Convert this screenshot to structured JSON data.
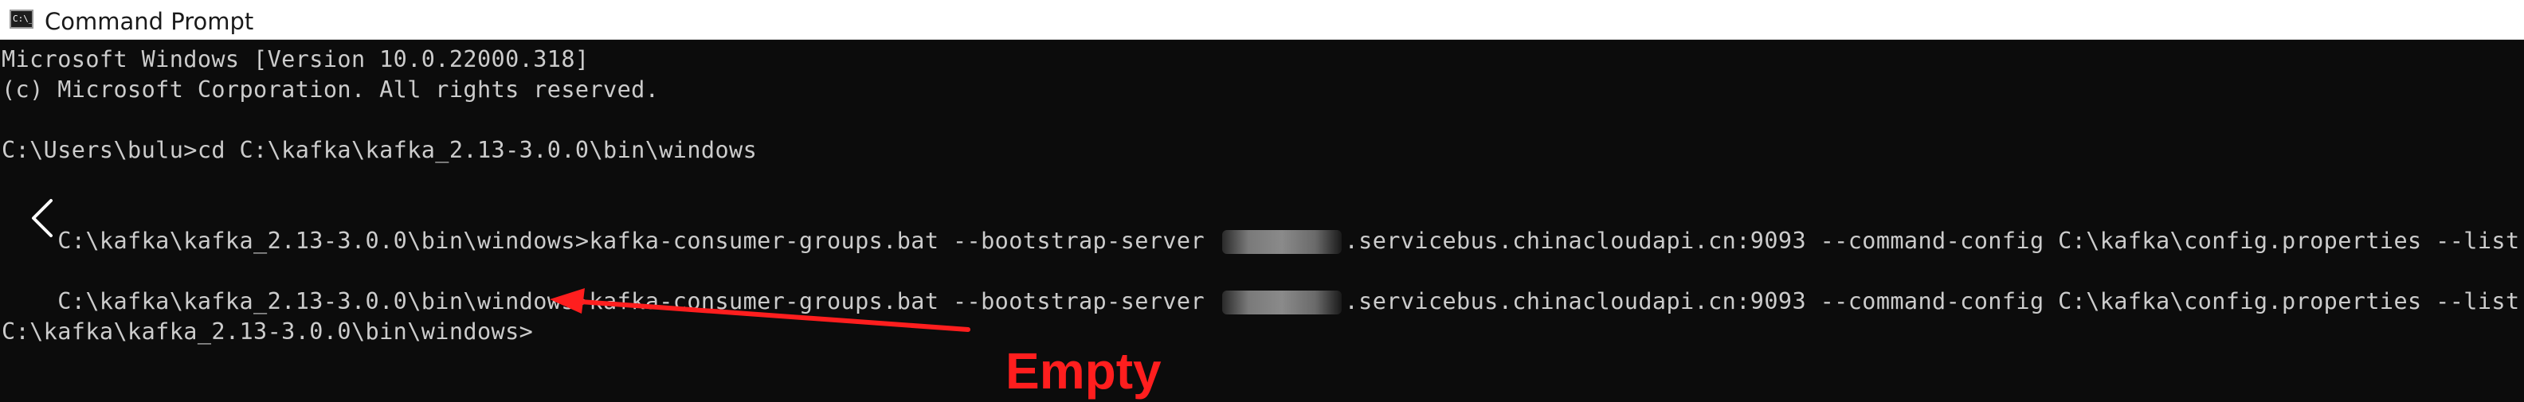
{
  "window": {
    "title": "Command Prompt",
    "icon": "cmd-icon",
    "icon_text": "C:\\_"
  },
  "console": {
    "lines": [
      {
        "text": "Microsoft Windows [Version 10.0.22000.318]"
      },
      {
        "text": "(c) Microsoft Corporation. All rights reserved."
      },
      {
        "text": ""
      },
      {
        "text": "C:\\Users\\bulu>cd C:\\kafka\\kafka_2.13-3.0.0\\bin\\windows"
      },
      {
        "text": ""
      },
      {
        "pre": "C:\\kafka\\kafka_2.13-3.0.0\\bin\\windows>kafka-consumer-groups.bat --bootstrap-server ",
        "post": ".servicebus.chinacloudapi.cn:9093 --command-config C:\\kafka\\config.properties --list"
      },
      {
        "text": ""
      },
      {
        "pre": "C:\\kafka\\kafka_2.13-3.0.0\\bin\\windows>kafka-consumer-groups.bat --bootstrap-server ",
        "post": ".servicebus.chinacloudapi.cn:9093 --command-config C:\\kafka\\config.properties --list"
      },
      {
        "text": ""
      },
      {
        "text": "C:\\kafka\\kafka_2.13-3.0.0\\bin\\windows>"
      }
    ]
  },
  "annotation": {
    "label": "Empty",
    "color": "#ff1e1e"
  },
  "colors": {
    "console_background": "#0c0c0c",
    "console_text": "#cccccc",
    "titlebar_background": "#ffffff"
  }
}
